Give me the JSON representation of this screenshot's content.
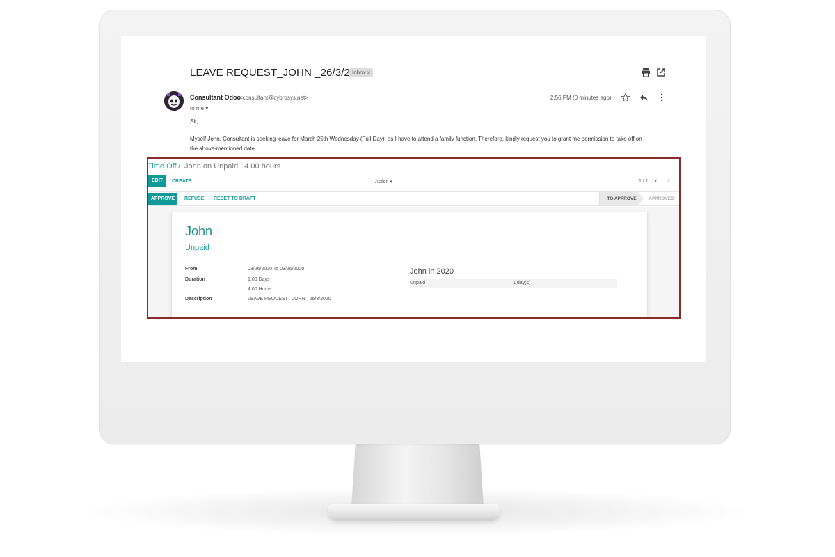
{
  "email": {
    "subject": "LEAVE REQUEST_JOHN _26/3/2020",
    "label_chip": "Inbox ×",
    "sender_name": "Consultant Odoo",
    "sender_email": "<consultant@cybrosys.net>",
    "recipient": "to me ▾",
    "timestamp": "2:56 PM (0 minutes ago)",
    "greeting": "Sir,",
    "body_line1": "Myself John, Consultant is seeking leave for March 25th Wednesday  (Full Day), as I have to attend a family function. Therefore, kindly request you to grant me permission to take off on",
    "body_line2": "the above-mentioned date.",
    "icons": [
      "print-icon",
      "open-new-window-icon",
      "star-icon",
      "reply-icon",
      "more-vert-icon"
    ]
  },
  "odoo": {
    "breadcrumb_root": "Time Off",
    "breadcrumb_sep": "/",
    "breadcrumb_current": "John on Unpaid : 4.00 hours",
    "edit_label": "EDIT",
    "create_label": "CREATE",
    "action_label": "Action ▾",
    "pager_text": "1 / 1",
    "approve_label": "APPROVE",
    "refuse_label": "REFUSE",
    "reset_label": "RESET TO DRAFT",
    "stage_current": "TO APPROVE",
    "stage_next": "APPROVED",
    "employee_name": "John",
    "leave_type": "Unpaid",
    "fields": {
      "from_label": "From",
      "from_value": "03/26/2020  To  03/26/2020",
      "duration_label": "Duration",
      "duration_days": "1.00  Days",
      "duration_hours": "4.00  Hours",
      "description_label": "Description",
      "description_value": "LEAVE REQUEST_ JOHN _26/3/2020"
    },
    "summary": {
      "title": "John in 2020",
      "type": "Unpaid",
      "days": "1 day(s)"
    }
  },
  "colors": {
    "accent": "#1a9e9a",
    "button_primary": "#0f9a97",
    "highlight_frame": "#8b2a2a"
  }
}
